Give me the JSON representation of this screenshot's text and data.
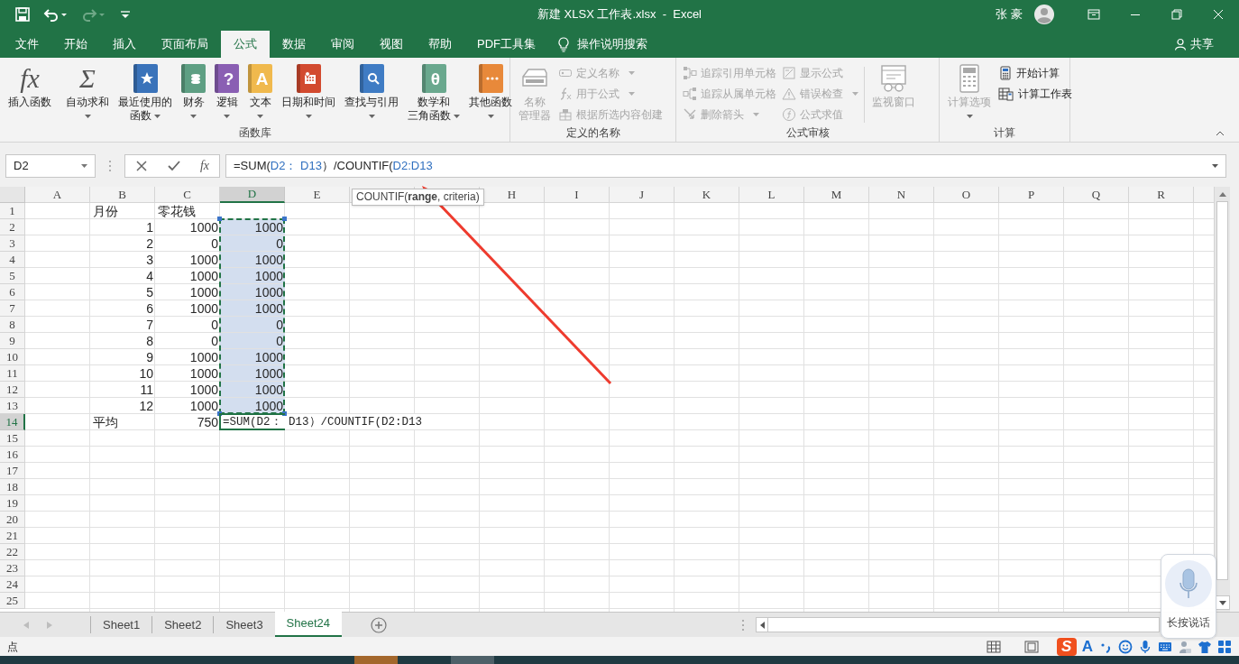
{
  "title_bar": {
    "quick_access": [
      {
        "kind": "save",
        "disabled": false
      },
      {
        "kind": "undo",
        "disabled": false
      },
      {
        "kind": "redo",
        "disabled": true
      },
      {
        "kind": "customize",
        "disabled": false
      }
    ],
    "title": "新建 XLSX 工作表.xlsx  -  Excel",
    "user": "张 豪"
  },
  "ribbon_tabs": [
    {
      "label": "文件",
      "selected": false
    },
    {
      "label": "开始",
      "selected": false
    },
    {
      "label": "插入",
      "selected": false
    },
    {
      "label": "页面布局",
      "selected": false
    },
    {
      "label": "公式",
      "selected": true
    },
    {
      "label": "数据",
      "selected": false
    },
    {
      "label": "审阅",
      "selected": false
    },
    {
      "label": "视图",
      "selected": false
    },
    {
      "label": "帮助",
      "selected": false
    },
    {
      "label": "PDF工具集",
      "selected": false
    }
  ],
  "tell_me": "操作说明搜索",
  "share": "共享",
  "ribbon_groups": [
    {
      "label": "函数库",
      "items": [
        {
          "kind": "large",
          "label_lines": [
            "插入函数"
          ],
          "glyph": "fx",
          "dropdown": false,
          "disabled": false
        },
        {
          "kind": "separator"
        },
        {
          "kind": "large",
          "label_lines": [
            "自动求和"
          ],
          "glyph": "Σ",
          "dropdown": true,
          "disabled": false
        },
        {
          "kind": "large",
          "label_lines": [
            "最近使用的",
            "函数"
          ],
          "color": "#3a73ba",
          "dropdown": true,
          "disabled": false
        },
        {
          "kind": "large",
          "label_lines": [
            "财务"
          ],
          "color": "#5e9f83",
          "dropdown": true,
          "disabled": false
        },
        {
          "kind": "large",
          "label_lines": [
            "逻辑"
          ],
          "glyph": "?",
          "color": "#8a5fb3",
          "dropdown": true,
          "disabled": false
        },
        {
          "kind": "large",
          "label_lines": [
            "文本"
          ],
          "glyph": "A",
          "color": "#f0b94d",
          "dropdown": true,
          "disabled": false
        },
        {
          "kind": "large",
          "label_lines": [
            "日期和时间"
          ],
          "color": "#d24a2f",
          "dropdown": true,
          "disabled": false
        },
        {
          "kind": "large",
          "label_lines": [
            "查找与引用"
          ],
          "color": "#3f7cc4",
          "dropdown": true,
          "disabled": false
        },
        {
          "kind": "large",
          "label_lines": [
            "数学和",
            "三角函数"
          ],
          "glyph": "θ",
          "color": "#6aa88e",
          "dropdown": true,
          "disabled": false
        },
        {
          "kind": "large",
          "label_lines": [
            "其他函数"
          ],
          "color": "#e8893a",
          "dropdown": true,
          "disabled": false
        }
      ]
    },
    {
      "label": "定义的名称",
      "items": [
        {
          "kind": "large",
          "label_lines": [
            "名称",
            "管理器"
          ],
          "dropdown": false,
          "disabled": true
        },
        {
          "kind": "column",
          "items": [
            {
              "label": "定义名称",
              "dropdown": true,
              "disabled": true
            },
            {
              "label": "用于公式",
              "dropdown": true,
              "disabled": true
            },
            {
              "label": "根据所选内容创建",
              "dropdown": false,
              "disabled": true
            }
          ]
        }
      ]
    },
    {
      "label": "公式审核",
      "items": [
        {
          "kind": "column",
          "items": [
            {
              "label": "追踪引用单元格",
              "dropdown": false,
              "disabled": true
            },
            {
              "label": "追踪从属单元格",
              "dropdown": false,
              "disabled": true
            },
            {
              "label": "删除箭头",
              "dropdown": true,
              "disabled": true
            }
          ]
        },
        {
          "kind": "column",
          "items": [
            {
              "label": "显示公式",
              "dropdown": false,
              "disabled": true
            },
            {
              "label": "错误检查",
              "dropdown": true,
              "disabled": true
            },
            {
              "label": "公式求值",
              "dropdown": false,
              "disabled": true
            }
          ]
        },
        {
          "kind": "separator"
        },
        {
          "kind": "large",
          "label_lines": [
            "监视窗口"
          ],
          "dropdown": false,
          "disabled": true
        }
      ]
    },
    {
      "label": "计算",
      "items": [
        {
          "kind": "large",
          "label_lines": [
            "计算选项"
          ],
          "dropdown": true,
          "disabled": true
        },
        {
          "kind": "column",
          "items": [
            {
              "label": "开始计算",
              "dropdown": false,
              "disabled": false
            },
            {
              "label": "计算工作表",
              "dropdown": false,
              "disabled": false
            }
          ]
        }
      ]
    }
  ],
  "formula_bar": {
    "name_box": "D2",
    "function_button": "fx",
    "formula": [
      {
        "text": "=SUM(",
        "reference": false
      },
      {
        "text": "D2： D13",
        "reference": true
      },
      {
        "text": "）/COUNTIF(",
        "reference": false
      },
      {
        "text": "D2:D13",
        "reference": true
      }
    ]
  },
  "tooltip": "COUNTIF(**range**, criteria)",
  "columns": [
    {
      "label": "A",
      "selected": false
    },
    {
      "label": "B",
      "selected": false
    },
    {
      "label": "C",
      "selected": false
    },
    {
      "label": "D",
      "selected": true
    },
    {
      "label": "E",
      "selected": false
    },
    {
      "selected": false
    },
    {
      "selected": false
    },
    {
      "label": "H",
      "selected": false
    },
    {
      "label": "I",
      "selected": false
    },
    {
      "label": "J",
      "selected": false
    },
    {
      "label": "K",
      "selected": false
    },
    {
      "label": "L",
      "selected": false
    },
    {
      "label": "M",
      "selected": false
    },
    {
      "label": "N",
      "selected": false
    },
    {
      "label": "O",
      "selected": false
    },
    {
      "label": "P",
      "selected": false
    },
    {
      "label": "Q",
      "selected": false
    },
    {
      "label": "R",
      "selected": false
    }
  ],
  "rows": [
    {
      "label": "1",
      "selected": false,
      "cells": [
        {
          "text": "月份",
          "kind": "text"
        },
        {
          "text": "零花钱",
          "kind": "text"
        }
      ]
    },
    {
      "label": "2",
      "selected": false,
      "cells": [
        {
          "text": "1",
          "kind": "number"
        },
        {
          "text": "1000",
          "kind": "number"
        },
        {
          "text": "1000",
          "kind": "number",
          "highlighted": true
        }
      ]
    },
    {
      "label": "3",
      "selected": false,
      "cells": [
        {
          "text": "2",
          "kind": "number"
        },
        {
          "text": "0",
          "kind": "number"
        },
        {
          "text": "0",
          "kind": "number",
          "highlighted": true
        }
      ]
    },
    {
      "label": "4",
      "selected": false,
      "cells": [
        {
          "text": "3",
          "kind": "number"
        },
        {
          "text": "1000",
          "kind": "number"
        },
        {
          "text": "1000",
          "kind": "number",
          "highlighted": true
        }
      ]
    },
    {
      "label": "5",
      "selected": false,
      "cells": [
        {
          "text": "4",
          "kind": "number"
        },
        {
          "text": "1000",
          "kind": "number"
        },
        {
          "text": "1000",
          "kind": "number",
          "highlighted": true
        }
      ]
    },
    {
      "label": "6",
      "selected": false,
      "cells": [
        {
          "text": "5",
          "kind": "number"
        },
        {
          "text": "1000",
          "kind": "number"
        },
        {
          "text": "1000",
          "kind": "number",
          "highlighted": true
        }
      ]
    },
    {
      "label": "7",
      "selected": false,
      "cells": [
        {
          "text": "6",
          "kind": "number"
        },
        {
          "text": "1000",
          "kind": "number"
        },
        {
          "text": "1000",
          "kind": "number",
          "highlighted": true
        }
      ]
    },
    {
      "label": "8",
      "selected": false,
      "cells": [
        {
          "text": "7",
          "kind": "number"
        },
        {
          "text": "0",
          "kind": "number"
        },
        {
          "text": "0",
          "kind": "number",
          "highlighted": true
        }
      ]
    },
    {
      "label": "9",
      "selected": false,
      "cells": [
        {
          "text": "8",
          "kind": "number"
        },
        {
          "text": "0",
          "kind": "number"
        },
        {
          "text": "0",
          "kind": "number",
          "highlighted": true
        }
      ]
    },
    {
      "label": "10",
      "selected": false,
      "cells": [
        {
          "text": "9",
          "kind": "number"
        },
        {
          "text": "1000",
          "kind": "number"
        },
        {
          "text": "1000",
          "kind": "number",
          "highlighted": true
        }
      ]
    },
    {
      "label": "11",
      "selected": false,
      "cells": [
        {
          "text": "10",
          "kind": "number"
        },
        {
          "text": "1000",
          "kind": "number"
        },
        {
          "text": "1000",
          "kind": "number",
          "highlighted": true
        }
      ]
    },
    {
      "label": "12",
      "selected": false,
      "cells": [
        {
          "text": "11",
          "kind": "number"
        },
        {
          "text": "1000",
          "kind": "number"
        },
        {
          "text": "1000",
          "kind": "number",
          "highlighted": true
        }
      ]
    },
    {
      "label": "13",
      "selected": false,
      "cells": [
        {
          "text": "12",
          "kind": "number"
        },
        {
          "text": "1000",
          "kind": "number"
        },
        {
          "text": "1000",
          "kind": "number",
          "highlighted": true
        }
      ]
    },
    {
      "label": "14",
      "selected": true,
      "cells": [
        {
          "text": "平均",
          "kind": "text"
        },
        {
          "text": "750",
          "kind": "number"
        },
        {
          "text": "=SUM(D2： D13）/COUNTIF(D2:D13",
          "kind": "formula"
        }
      ]
    },
    {
      "label": "15",
      "selected": false
    },
    {
      "label": "16",
      "selected": false
    },
    {
      "label": "17",
      "selected": false
    },
    {
      "label": "18",
      "selected": false
    },
    {
      "label": "19",
      "selected": false
    },
    {
      "label": "20",
      "selected": false
    },
    {
      "label": "21",
      "selected": false
    },
    {
      "label": "22",
      "selected": false
    },
    {
      "label": "23",
      "selected": false
    },
    {
      "label": "24",
      "selected": false
    },
    {
      "label": "25",
      "selected": false
    }
  ],
  "sheet_tabs": [
    {
      "label": "Sheet1",
      "selected": false
    },
    {
      "label": "Sheet2",
      "selected": false
    },
    {
      "label": "Sheet3",
      "selected": false
    },
    {
      "label": "Sheet24",
      "selected": true
    }
  ],
  "status": "点",
  "ime_bar": {
    "logo": "S",
    "font_glyph": "A"
  },
  "voice_widget": {
    "label": "长按说话"
  }
}
